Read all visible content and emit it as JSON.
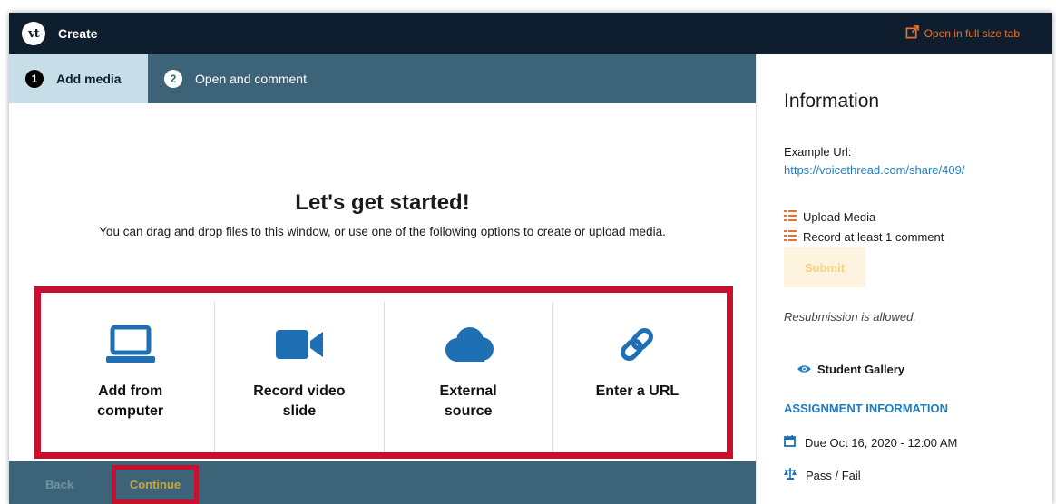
{
  "topbar": {
    "logo_text": "vt",
    "title": "Create",
    "open_full_label": "Open in full size tab",
    "accent": "#e8702a"
  },
  "tabs": [
    {
      "num": "1",
      "label": "Add media",
      "active": true
    },
    {
      "num": "2",
      "label": "Open and comment",
      "active": false
    }
  ],
  "main": {
    "heading": "Let's get started!",
    "subtext": "You can drag and drop files to this window, or use one of the following options to create or upload media.",
    "options": [
      {
        "label": "Add from computer",
        "icon": "laptop-icon"
      },
      {
        "label": "Record video slide",
        "icon": "video-camera-icon"
      },
      {
        "label": "External source",
        "icon": "cloud-icon"
      },
      {
        "label": "Enter a URL",
        "icon": "link-icon"
      }
    ]
  },
  "bottombar": {
    "back_label": "Back",
    "continue_label": "Continue"
  },
  "sidebar": {
    "title": "Information",
    "example_label": "Example Url:",
    "example_url": "https://voicethread.com/share/409/",
    "requirements": [
      "Upload Media",
      "Record at least 1 comment"
    ],
    "submit_label": "Submit",
    "resubmission_text": "Resubmission is allowed.",
    "gallery_label": "Student Gallery",
    "assignment_heading": "ASSIGNMENT INFORMATION",
    "due_text": "Due Oct 16, 2020 - 12:00 AM",
    "grading_text": "Pass / Fail"
  },
  "colors": {
    "topbar_bg": "#0f1e2e",
    "tab_bar_bg": "#3c6378",
    "active_tab_bg": "#c7dde8",
    "icon_blue": "#1f6fb5",
    "highlight_red": "#c8102e",
    "link_blue": "#1f7ec1",
    "requirement_orange": "#e8702a"
  }
}
